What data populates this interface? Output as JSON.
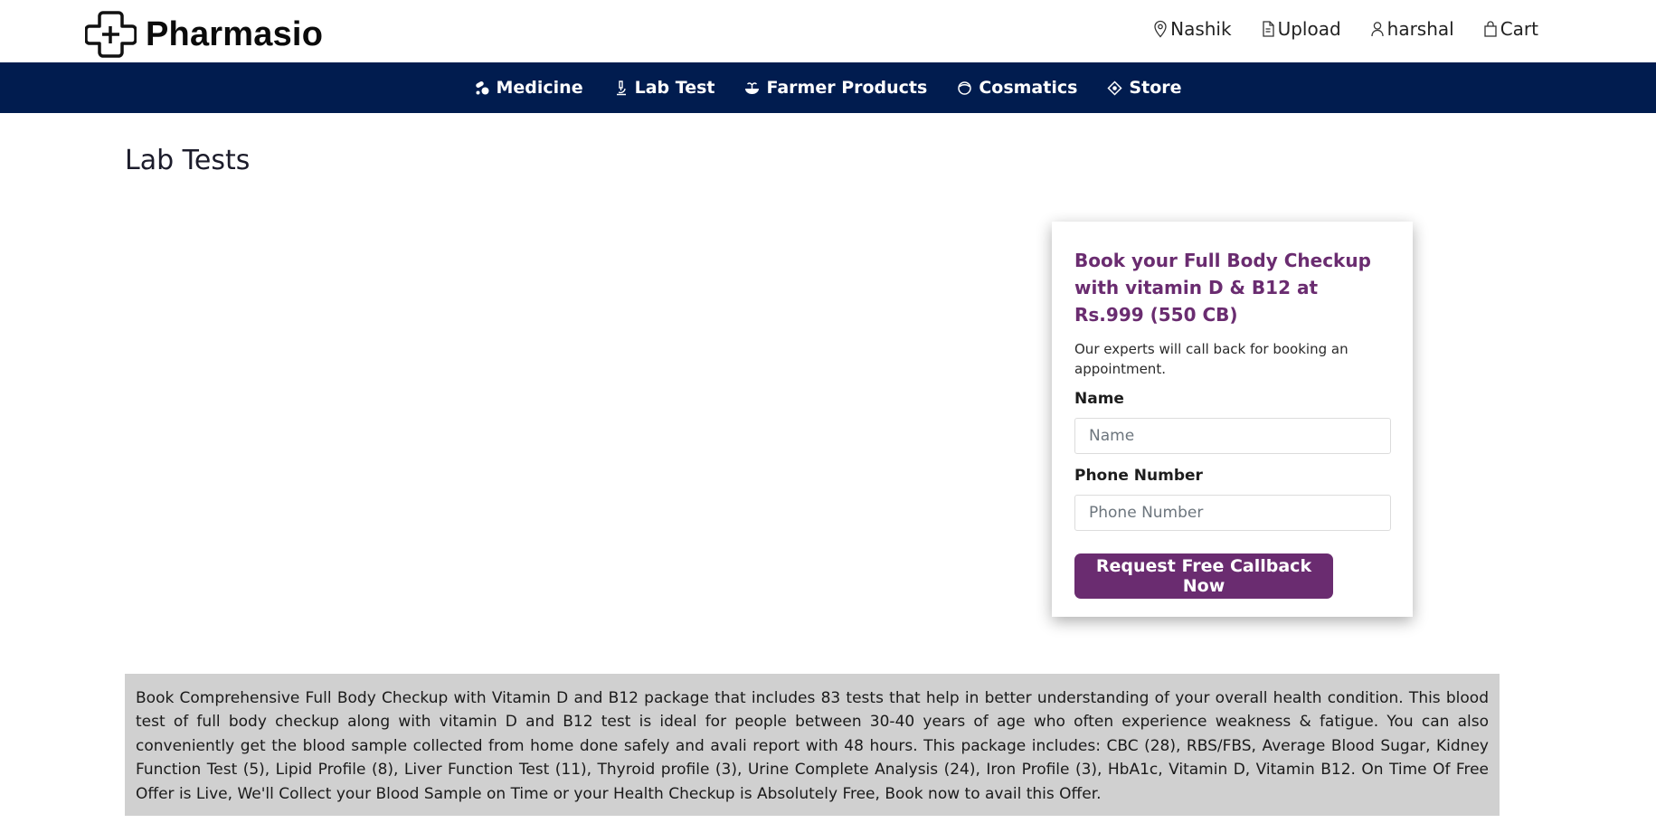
{
  "brand": {
    "name": "Pharmasio",
    "logo_icon": "plus-cross-logo-icon"
  },
  "top_links": [
    {
      "label": "Nashik",
      "icon": "location-pin-icon"
    },
    {
      "label": "Upload",
      "icon": "document-icon"
    },
    {
      "label": "harshal",
      "icon": "user-icon"
    },
    {
      "label": "Cart",
      "icon": "shopping-bag-icon"
    }
  ],
  "nav": [
    {
      "label": "Medicine",
      "icon": "capsules-icon"
    },
    {
      "label": "Lab Test",
      "icon": "microscope-icon"
    },
    {
      "label": "Farmer Products",
      "icon": "plant-bowl-icon"
    },
    {
      "label": "Cosmatics",
      "icon": "face-cream-icon"
    },
    {
      "label": "Store",
      "icon": "store-icon"
    }
  ],
  "page": {
    "title": "Lab Tests"
  },
  "booking_card": {
    "title": "Book your Full Body Checkup with vitamin D & B12 at Rs.999 (550 CB)",
    "subtitle": "Our experts will call back for booking an appointment.",
    "name_label": "Name",
    "name_placeholder": "Name",
    "phone_label": "Phone Number",
    "phone_placeholder": "Phone Number",
    "submit_label": "Request Free Callback Now"
  },
  "description": "Book Comprehensive Full Body Checkup with Vitamin D and B12 package that includes 83 tests that help in better understanding of your overall health condition. This blood test of full body checkup along with vitamin D and B12 test is ideal for people between 30-40 years of age who often experience weakness & fatigue. You can also conveniently get the blood sample collected from home done safely and avali report with 48 hours. This package includes: CBC (28), RBS/FBS, Average Blood Sugar, Kidney Function Test (5), Lipid Profile (8), Liver Function Test (11), Thyroid profile (3), Urine Complete Analysis (24), Iron Profile (3), HbA1c, Vitamin D, Vitamin B12. On Time Of Free Offer is Live, We'll Collect your Blood Sample on Time or your Health Checkup is Absolutely Free, Book now to avail this Offer.",
  "colors": {
    "navbar": "#011c4f",
    "accent_purple": "#6a2c70",
    "description_bg": "#d0d0d0"
  }
}
